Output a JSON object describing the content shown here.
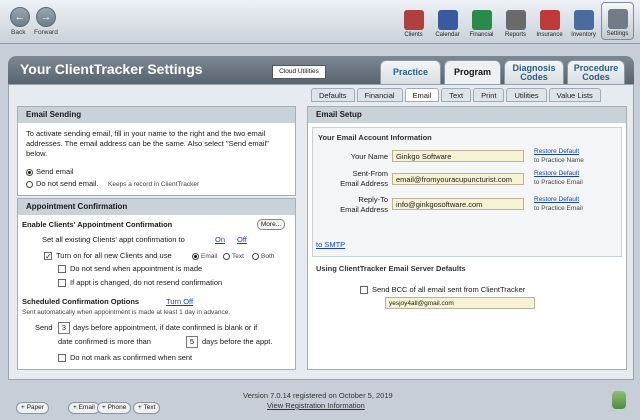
{
  "nav": {
    "back_label": "Back",
    "forward_label": "Forward"
  },
  "toolbar": {
    "items": [
      {
        "label": "Clients",
        "icon": "clients-icon",
        "color": "#b04040"
      },
      {
        "label": "Calendar",
        "icon": "calendar-icon",
        "color": "#3a5aa0"
      },
      {
        "label": "Financial",
        "icon": "financial-icon",
        "color": "#2a8a4a"
      },
      {
        "label": "Reports",
        "icon": "reports-icon",
        "color": "#6a6a6a"
      },
      {
        "label": "Insurance",
        "icon": "insurance-icon",
        "color": "#c03a3a"
      },
      {
        "label": "Inventory",
        "icon": "inventory-icon",
        "color": "#4a6aa0"
      },
      {
        "label": "Settings",
        "icon": "settings-icon",
        "color": "#707c88"
      }
    ]
  },
  "header": {
    "title": "Your ClientTracker Settings",
    "cloud_button": "Cloud Utilities"
  },
  "main_tabs": [
    "Practice",
    "Program",
    "Diagnosis\nCodes",
    "Procedure\nCodes"
  ],
  "sub_tabs": [
    "Defaults",
    "Financial",
    "Email",
    "Text",
    "Print",
    "Utilities",
    "Value Lists"
  ],
  "left": {
    "email_sending": {
      "heading": "Email Sending",
      "description": "To activate sending email, fill in your name to the right and the two email addresses. The email address can be the same. Also select \"Send email\" below.",
      "opt_send": "Send email",
      "opt_no_send": "Do not send email.",
      "opt_no_send_note": "Keeps a record in ClientTracker"
    },
    "appt": {
      "heading": "Appointment Confirmation",
      "enable_label": "Enable Clients' Appointment Confirmation",
      "more_button": "More...",
      "set_all_label": "Set all existing Clients' appt confirmation to",
      "on_link": "On",
      "off_link": "Off",
      "turn_on_label": "Turn on for all new Clients and use",
      "mode_email": "Email",
      "mode_text": "Text",
      "mode_both": "Both",
      "no_send_made": "Do not send when appointment is made",
      "no_resend": "If appt is changed, do not resend confirmation",
      "scheduled_label": "Scheduled Confirmation Options",
      "turn_off_link": "Turn Off",
      "auto_note": "Sent automatically when appointment is made at least 1 day in advance.",
      "send_word": "Send",
      "days_before": "3",
      "days_text": "days before appointment, if date confirmed is blank or if",
      "date_confirmed_text": "date confirmed is more than",
      "days_after": "5",
      "days_before_appt": "days before the appt.",
      "no_mark": "Do not mark as confirmed when sent"
    }
  },
  "right": {
    "heading": "Email Setup",
    "account_heading": "Your Email Account Information",
    "name_label": "Your Name",
    "name_value": "Ginkgo Software",
    "from_label": "Sent-From\nEmail Address",
    "from_value": "email@fromyouracupuncturist.com",
    "reply_label": "Reply-To\nEmail Address",
    "reply_value": "info@ginkgosoftware.com",
    "restore_link": "Restore Default",
    "restore_name_note": "to Practice Name",
    "restore_email_note": "to Practice Email",
    "smtp_link": "to SMTP",
    "server_heading": "Using ClientTracker Email Server Defaults",
    "bcc_label": "Send BCC of all email sent from ClientTracker",
    "bcc_value": "yesjoy4all@gmail.com"
  },
  "footer": {
    "version": "Version 7.0.14 registered on October 5, 2019",
    "registration_link": "View Registration Information",
    "buttons": [
      "+ Paper",
      "+ Email",
      "+ Phone",
      "+ Text"
    ]
  }
}
